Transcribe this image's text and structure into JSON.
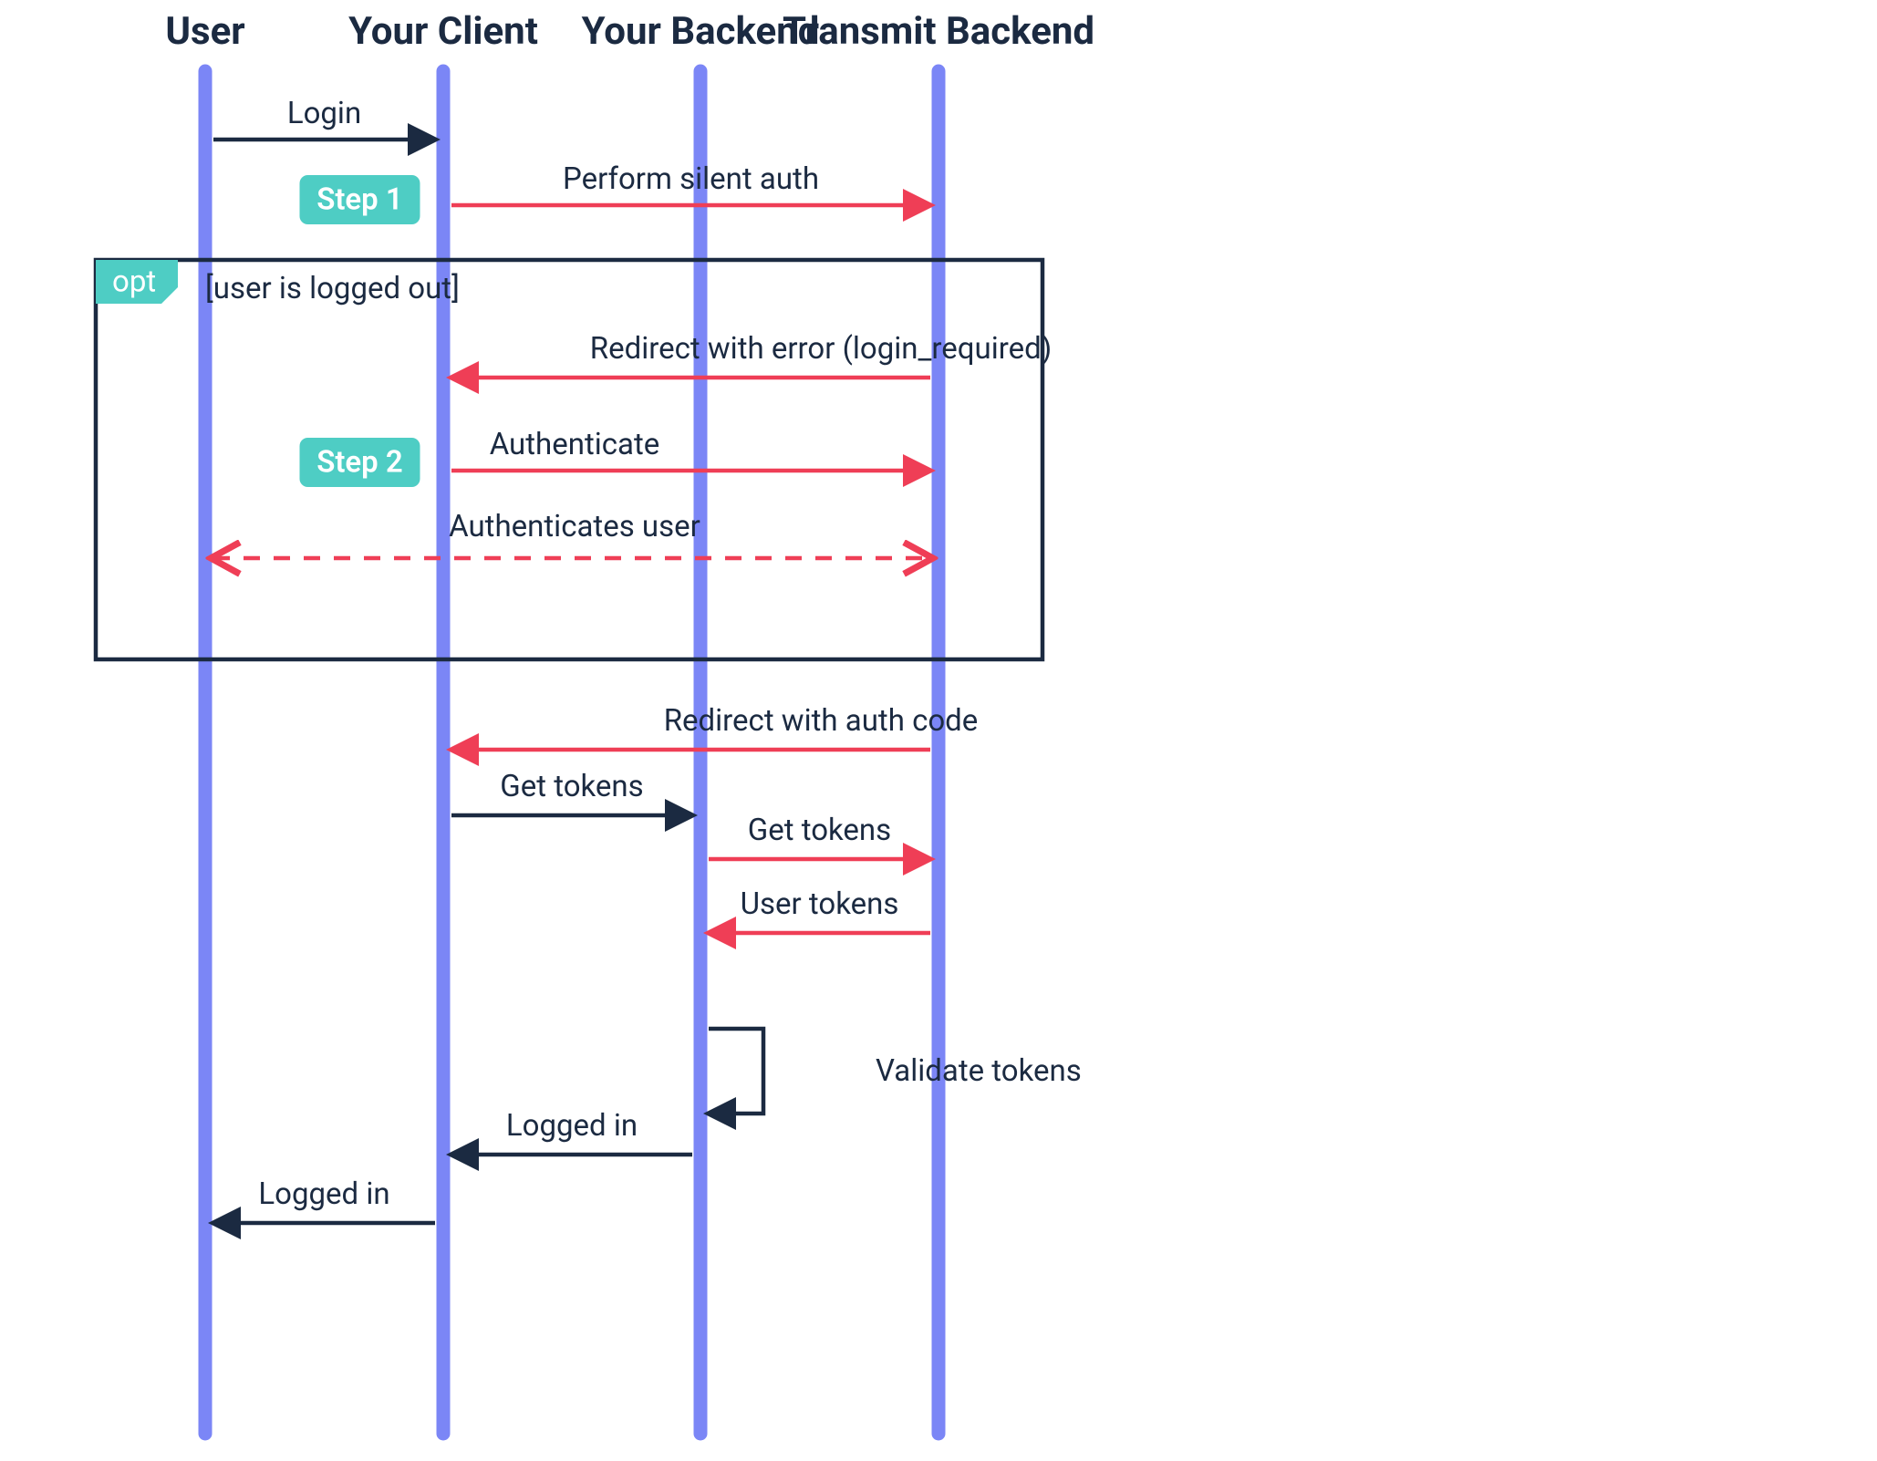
{
  "participants": {
    "user": "User",
    "client": "Your Client",
    "backend": "Your Backend",
    "transmit": "Transmit Backend"
  },
  "steps": {
    "step1": "Step 1",
    "step2": "Step 2"
  },
  "fragment": {
    "kind": "opt",
    "guard": "[user is logged out]"
  },
  "messages": {
    "login": "Login",
    "silent_auth": "Perform silent auth",
    "redirect_error": "Redirect with error (login_required)",
    "authenticate": "Authenticate",
    "authenticates_user": "Authenticates user",
    "redirect_auth_code": "Redirect with auth code",
    "get_tokens_1": "Get tokens",
    "get_tokens_2": "Get tokens",
    "user_tokens": "User tokens",
    "validate_tokens": "Validate tokens",
    "logged_in_1": "Logged in",
    "logged_in_2": "Logged in"
  }
}
